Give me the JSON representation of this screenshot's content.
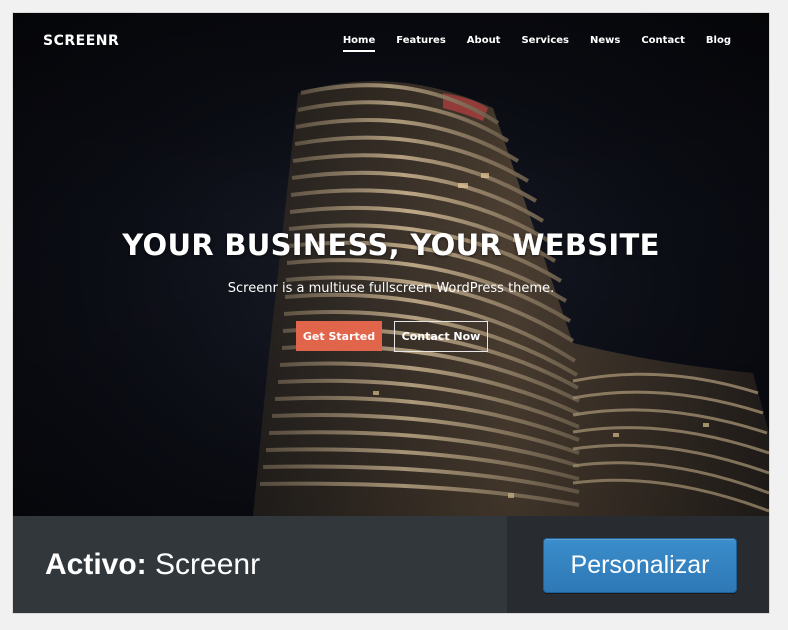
{
  "site": {
    "brand": "SCREENR",
    "nav": [
      "Home",
      "Features",
      "About",
      "Services",
      "News",
      "Contact",
      "Blog"
    ],
    "active_nav": "Home",
    "hero_title": "YOUR BUSINESS, YOUR WEBSITE",
    "hero_subtitle": "Screenr is a multiuse fullscreen WordPress theme.",
    "primary_button": "Get Started",
    "secondary_button": "Contact Now"
  },
  "theme_card": {
    "active_prefix": "Activo:",
    "theme_name": "Screenr",
    "customize_button": "Personalizar"
  },
  "colors": {
    "accent": "#e0654b",
    "wp_blue": "#2e78b6",
    "footer_bg": "#32373c"
  }
}
